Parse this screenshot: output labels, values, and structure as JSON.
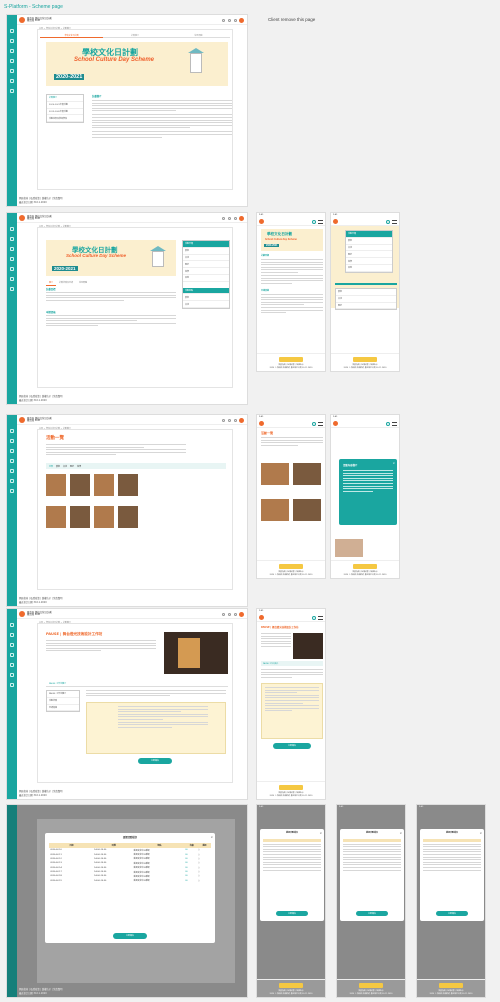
{
  "page": {
    "title": "S-Platform - Scheme page",
    "remove_note": "Client remove this page"
  },
  "brand": {
    "org_name_line1": "教育局 學校文化日計劃",
    "org_name_line2": "教育局 EDB",
    "accent_teal": "#1aa6a0",
    "accent_orange": "#ef6a2d"
  },
  "banner": {
    "title_cn": "學校文化日計劃",
    "title_en": "School Culture Day Scheme",
    "year": "2020-2021"
  },
  "section1": {
    "breadcrumb": "主頁 > 學校文化日計劃 > 計劃簡介",
    "tabs": [
      "學校文化日計劃",
      "計劃簡介",
      "常見問題"
    ],
    "left_menu": [
      "計劃簡介",
      "2020-2021年度活動",
      "2019-2020年度活動",
      "活動花絮及參加學校"
    ],
    "content_head": "計劃簡介"
  },
  "section2": {
    "menu_head": "活動分類",
    "menu_items": [
      "藝術",
      "文化",
      "歷史",
      "科學",
      "其他"
    ],
    "sub_head": "活動地點",
    "tabs": [
      "簡介",
      "計劃詳情及申請",
      "常見問題"
    ],
    "head1": "計劃目標",
    "head2": "申請資格"
  },
  "section3": {
    "title": "活動一覽",
    "filters": [
      "全部",
      "藝術",
      "文化",
      "歷史",
      "科學"
    ],
    "modal_title": "活動內容簡介"
  },
  "section4": {
    "title": "PAUSE | 舞台燈光技術設計工作坊",
    "tab1": "PAUSE 工作坊簡介",
    "button": "立即報名",
    "tab_label2": "PAUSE 工作坊簡介",
    "tab_label3": "活動詳情"
  },
  "section5": {
    "modal_title": "選擇活動場次",
    "columns": [
      "日期",
      "時間",
      "地點",
      "名額",
      "選擇"
    ],
    "rows": [
      [
        "2020-02-10",
        "14:00-15:30",
        "香港文化中心劇場",
        "30",
        "○"
      ],
      [
        "2020-02-11",
        "14:00-15:30",
        "香港文化中心劇場",
        "30",
        "○"
      ],
      [
        "2020-02-12",
        "14:00-15:30",
        "香港文化中心劇場",
        "30",
        "○"
      ],
      [
        "2020-02-13",
        "14:00-15:30",
        "香港文化中心劇場",
        "30",
        "○"
      ],
      [
        "2020-02-14",
        "14:00-15:30",
        "香港文化中心劇場",
        "30",
        "○"
      ],
      [
        "2020-02-17",
        "14:00-15:30",
        "香港文化中心劇場",
        "30",
        "○"
      ],
      [
        "2020-02-18",
        "14:00-15:30",
        "香港文化中心劇場",
        "30",
        "○"
      ],
      [
        "2020-02-19",
        "14:00-15:30",
        "香港文化中心劇場",
        "30",
        "○"
      ]
    ],
    "button": "立即報名"
  },
  "mobile": {
    "status_time": "9:41",
    "footer_links": "網頁指南 | 私隱政策 | 版權告示",
    "footer_copy": "2020 © 教育局 版權所有 最近修訂日期 30.11.2020"
  },
  "footer": {
    "links": "網頁指南 | 私隱政策 | 版權告示 | 免責聲明",
    "copy": "最近修訂日期 30.11.2020"
  }
}
